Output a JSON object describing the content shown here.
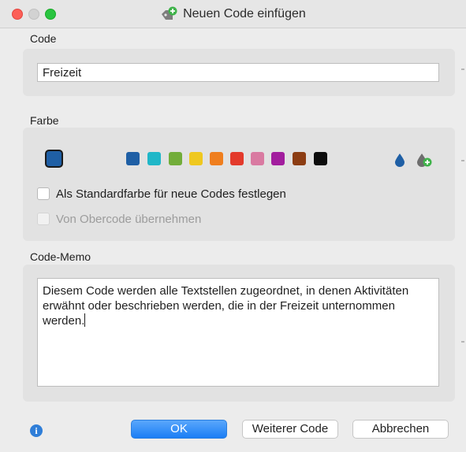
{
  "window": {
    "title": "Neuen Code einfügen",
    "title_icon": "code-add-icon"
  },
  "code_section": {
    "label": "Code",
    "input_value": "Freizeit"
  },
  "color_section": {
    "label": "Farbe",
    "selected_color": "#1f5fa5",
    "palette": [
      "#1f5fa5",
      "#20b7c8",
      "#72ad3a",
      "#efc81f",
      "#ef7e1e",
      "#e33a2c",
      "#d97aa1",
      "#a21e9e",
      "#8c3d13",
      "#0d0d0d"
    ],
    "icons": [
      "color-drop-icon",
      "add-color-icon"
    ],
    "checkbox_default": {
      "label": "Als Standardfarbe für neue Codes festlegen",
      "checked": false
    },
    "checkbox_parent": {
      "label": "Von Obercode übernehmen",
      "checked": false,
      "disabled": true
    }
  },
  "memo_section": {
    "label": "Code-Memo",
    "text": "Diesem Code werden alle Textstellen zugeordnet, in denen Aktivitäten erwähnt oder beschrieben werden, die in der Freizeit unternommen werden."
  },
  "footer": {
    "info_icon": "info-icon",
    "ok_label": "OK",
    "another_label": "Weiterer Code",
    "cancel_label": "Abbrechen",
    "accent_color": "#1b7ef5"
  }
}
